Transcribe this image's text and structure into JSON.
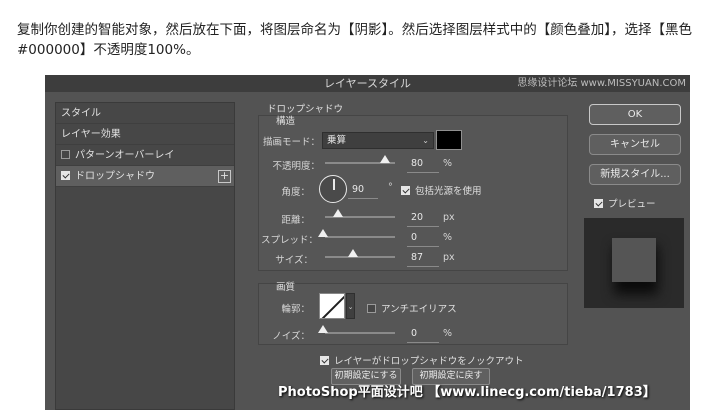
{
  "intro_text": "复制你创建的智能对象，然后放在下面，将图层命名为【阴影】。然后选择图层样式中的【颜色叠加】，选择【黑色#000000】不透明度100%。",
  "dialog": {
    "title": "レイヤースタイル",
    "watermark_top": "思缘设计论坛 www.MISSYUAN.COM"
  },
  "left_panel": {
    "items": [
      {
        "label": "スタイル"
      },
      {
        "label": "レイヤー効果"
      },
      {
        "label": "パターンオーバーレイ",
        "checked": false
      },
      {
        "label": "ドロップシャドウ",
        "checked": true,
        "plus": "+"
      }
    ]
  },
  "drop_shadow": {
    "section_title": "ドロップシャドウ",
    "structure": {
      "group_title": "構造",
      "blend_mode_label": "描画モード：",
      "blend_mode_value": "乗算",
      "shadow_color": "#000000",
      "opacity_label": "不透明度：",
      "opacity_value": "80",
      "opacity_unit": "%",
      "opacity_percent": 80,
      "angle_label": "角度：",
      "angle_value": "90",
      "angle_unit": "°",
      "global_light_label": "包括光源を使用",
      "global_light_checked": true,
      "distance_label": "距離：",
      "distance_value": "20",
      "distance_unit": "px",
      "spread_label": "スプレッド：",
      "spread_value": "0",
      "spread_unit": "%",
      "size_label": "サイズ：",
      "size_value": "87",
      "size_unit": "px"
    },
    "quality": {
      "group_title": "画質",
      "contour_label": "輪郭：",
      "anti_alias_label": "アンチエイリアス",
      "anti_alias_checked": false,
      "noise_label": "ノイズ：",
      "noise_value": "0",
      "noise_unit": "%"
    },
    "knockout_label": "レイヤーがドロップシャドウをノックアウト",
    "knockout_checked": true,
    "make_default_label": "初期設定にする",
    "reset_default_label": "初期設定に戻す"
  },
  "buttons": {
    "ok": "OK",
    "cancel": "キャンセル",
    "new_style": "新規スタイル...",
    "preview_label": "プレビュー",
    "preview_checked": true
  },
  "bottom_watermark": "PhotoShop平面设计吧 【www.linecg.com/tieba/1783】"
}
